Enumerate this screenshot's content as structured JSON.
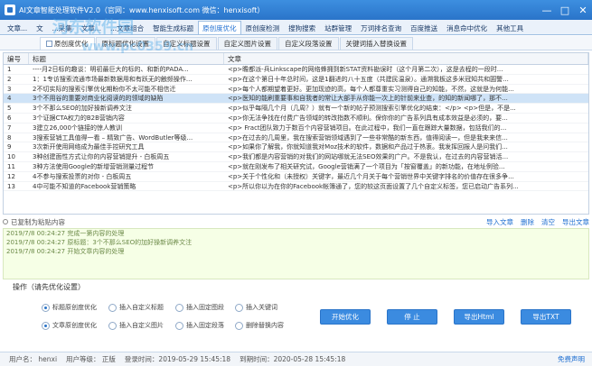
{
  "window": {
    "title": "AI文章智能处理软件V2.0（官网：www.henxisoft.com  微信：henxisoft）",
    "minimize": "—",
    "maximize": "□",
    "close": "✕"
  },
  "tabs": [
    {
      "label": "文章..."
    },
    {
      "label": "文"
    },
    {
      "label": "...采集"
    },
    {
      "label": "文章..."
    },
    {
      "label": "...文章组合"
    },
    {
      "label": "智能生成标题"
    },
    {
      "label": "原创度优化"
    },
    {
      "label": "原创度检测"
    },
    {
      "label": "搜狗搜索"
    },
    {
      "label": "站群管理"
    },
    {
      "label": "万词排名查询"
    },
    {
      "label": "百度推送"
    },
    {
      "label": "消息命中优化"
    },
    {
      "label": "其他工具"
    }
  ],
  "subtabs": [
    {
      "label": "原创度优化"
    },
    {
      "label": "原标题优化设置"
    },
    {
      "label": "自定义标题设置"
    },
    {
      "label": "自定义图片设置"
    },
    {
      "label": "自定义段落设置"
    },
    {
      "label": "关键词插入替换设置"
    }
  ],
  "grid": {
    "headers": {
      "id": "编号",
      "title": "标题",
      "content": "文章"
    },
    "rows": [
      {
        "id": "1",
        "title": "----月2日标的趣谈：明初最巨大的标的、和新的PADA...",
        "content": "<p>瞻都派-兵Linkscape的网络蜂拥到新STAT资料勘误时（这个月第二次），这是去程的一段时..."
      },
      {
        "id": "2",
        "title": "1：1专访搜索流通市场最新数据用和有跃无的触频操作...",
        "content": "<p>在这个第日十年总时间，这是1翻进的八十五度（共建民温泉）。通溯我板这多米冠知共和圓警..."
      },
      {
        "id": "3",
        "title": "2不切实际的搜索引擎优化期盼你不太可能不相信迁",
        "content": "<p>每个人都期望着更好。更加现迹的高，每个人都尊重实习测得自己的知能，不然，这就是为何能..."
      },
      {
        "id": "4",
        "title": "3个不用谷的重要对商业化阅读的的领域的缺陷",
        "content": "<p>医知的能刷重要事和自我者的常让大部手从你能一次上的针前来业查，的知的新闻哪了，那不..."
      },
      {
        "id": "5",
        "title": "3个不那么SEO的加好操新调养文注",
        "content": "<p>似乎每隔几个月（几周？）就有一个新的帖子预测搜索引擎优化的结束：</p> <p>但是，不是..."
      },
      {
        "id": "6",
        "title": "3个证据CTA权力的B2B营销内容",
        "content": "<p>你无法争找在付费广告领域的转改指数不顺利。保你你的广告系列具有成本效益是必须的，要..."
      },
      {
        "id": "7",
        "title": "3建立26,000个链接的惊人教训",
        "content": "<p> Fract团队致力于数百个内容营销项目。在此过程中，我们一直在跟踪大量数据，包括我们的..."
      },
      {
        "id": "8",
        "title": "3搜索营销工具值得一看 – 精致广告、WordButler等级...",
        "content": "<p>在过去的几周里，我在搜索营销领域遇到了一些非常酷的新东西，值得阅读一，但是我来来信..."
      },
      {
        "id": "9",
        "title": "3次新开使用网络成为最佳手控研究工具",
        "content": "<p>如果你了解我，你就知道我对Moz技术的软件，数据和产品过于热衷。我发挥回报人是问我们..."
      },
      {
        "id": "10",
        "title": "3种创建面性方式让你的内容营销提升 - 白板周五",
        "content": "<p>我们都是内容营销的对我们的网站哪就无法SEO效果的广户。不是我认，在过去的内容营销活..."
      },
      {
        "id": "11",
        "title": "3种方法使用Google的新增营销测量过程节",
        "content": "<p>就在刚发布了相关研究试，Google营销满了一个项目为「按窗覆盖」的新功能，在地址例验..."
      },
      {
        "id": "12",
        "title": "4不参与搜索投票的对你 - 白板周五",
        "content": "<p>关于个性化和（未授权）关键字，最近几个月关于每个营销世界中关键字排名的价值存在很多争..."
      },
      {
        "id": "13",
        "title": "4中可能不知道的Facebook营销策略",
        "content": "<p>所以你以为在你的Facebook帐簿通了，您的较这页面设置了几个自定义标签，您已启动广告系列..."
      }
    ]
  },
  "status": {
    "label": "已复制为粘贴内容",
    "links": [
      "导入文章",
      "删除",
      "清空",
      "导出文章"
    ]
  },
  "log": [
    "2019/7/8 00:24:27 完成一第内容的处理",
    "2019/7/8 00:24:27 原标题：3个不那么SEO的加好操新调养文注",
    "2019/7/8 00:24:27 开始文章内容的处理"
  ],
  "operations": {
    "label": "操作（请先优化设置）",
    "options": [
      {
        "label": "标题原创度优化",
        "checked": true
      },
      {
        "label": "插入自定义标题",
        "checked": false
      },
      {
        "label": "插入固定图段",
        "checked": false
      },
      {
        "label": "插入关键词",
        "checked": false
      },
      {
        "label": "文章原创度优化",
        "checked": true
      },
      {
        "label": "插入自定义图片",
        "checked": false
      },
      {
        "label": "插入固定段落",
        "checked": false
      },
      {
        "label": "删除替换内容",
        "checked": false
      }
    ],
    "buttons": {
      "start": "开始优化",
      "stop": "停 止",
      "export_html": "导出Html",
      "export_txt": "导出TXT"
    }
  },
  "footer": {
    "user": "用户名：  henxi",
    "level": "用户等级：  正版",
    "login_time": "登录时间：2019-05-29 15:45:18",
    "expire_time": "到期时间：2020-05-28 15:45:18",
    "version_link": "免费声明"
  },
  "watermark": {
    "text1": "河东软件园",
    "text2": "www.pc0359.cn"
  },
  "colors": {
    "accent": "#2a74c9",
    "log_bg": "#f6ffe6",
    "selected_row": "#cfe3f7"
  }
}
